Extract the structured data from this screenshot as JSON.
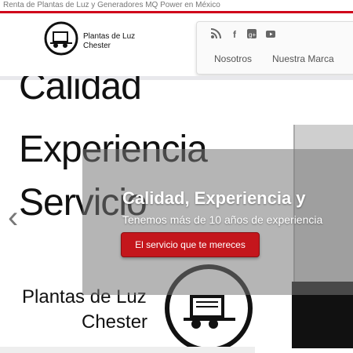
{
  "topbar": {
    "text": "Renta de Plantas de Luz y Generadores MQ Power en México"
  },
  "header": {
    "logo_line1": "Plantas de Luz",
    "logo_line2": "Chester",
    "social": [
      "rss-icon",
      "facebook-icon",
      "google-plus-icon",
      "youtube-icon"
    ],
    "nav": [
      "Nosotros",
      "Nuestra Marca"
    ]
  },
  "hero": {
    "words": [
      "Calidad",
      "Experiencia",
      "Servicio"
    ],
    "logo_line1": "Plantas de Luz",
    "logo_line2": "Chester",
    "caption_title": "Calidad, Experiencia y",
    "caption_sub": "Tenemos más de 10 años de experiencia",
    "cta": "El servicio que te mereces"
  },
  "colors": {
    "accent": "#c4161c",
    "topline": "#d0021b"
  }
}
